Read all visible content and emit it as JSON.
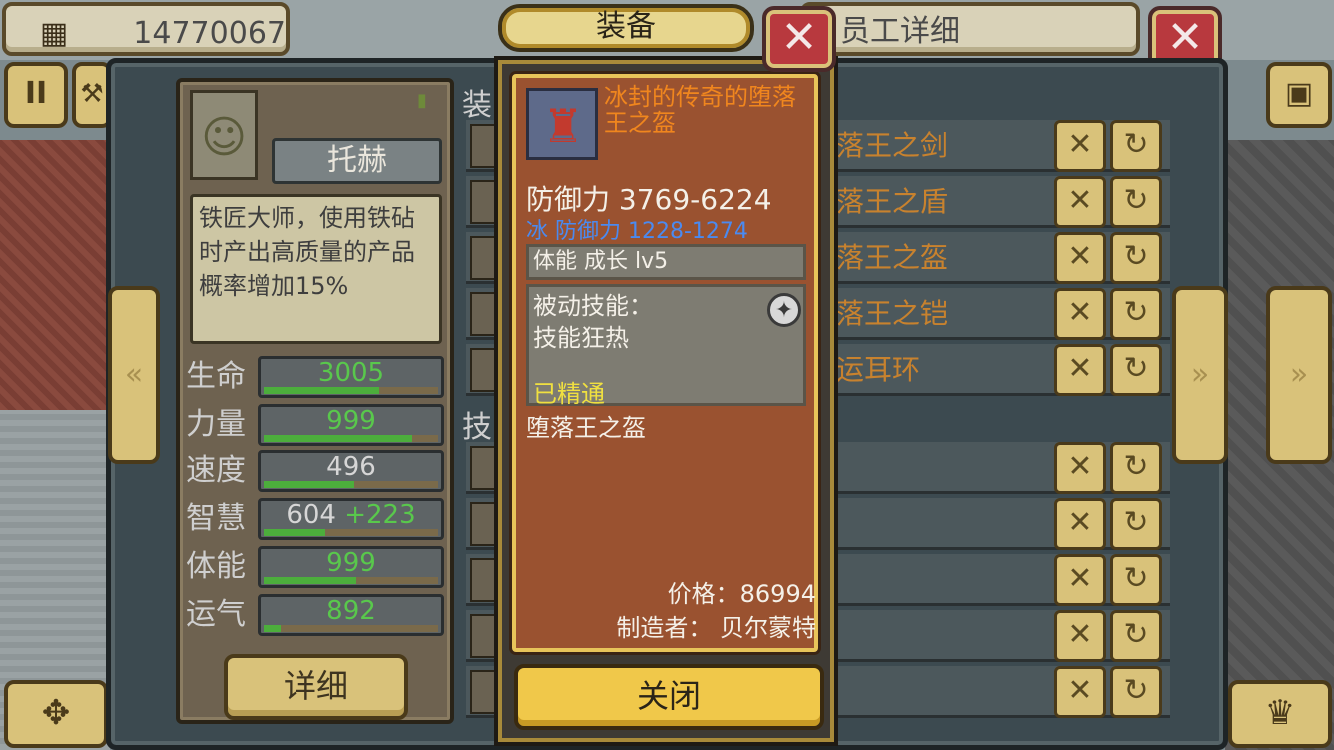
{
  "top_bar": {
    "coin_icon": "building-icon",
    "coin_value": "14770067",
    "staff_detail_title": "员工详细",
    "close_glyph": "✕"
  },
  "side_buttons": {
    "pause_glyph": "II",
    "hammer_glyph": "⚒",
    "camera_glyph": "▣",
    "move_glyph": "✥",
    "shop_glyph": "♛",
    "left_nav_glyph": "«",
    "right_nav_glyph": "»"
  },
  "character": {
    "name": "托赫",
    "portrait_glyph": "☺",
    "medal_glyph": "🎖",
    "description": "铁匠大师，使用铁砧时产出高质量的产品概率增加15%",
    "stats": [
      {
        "label": "生命",
        "value": "3005",
        "bonus": "",
        "fill": 0.66,
        "color": "#59c84c"
      },
      {
        "label": "力量",
        "value": "999",
        "bonus": "",
        "fill": 0.85,
        "color": "#59c84c"
      },
      {
        "label": "速度",
        "value": "496",
        "bonus": "",
        "fill": 0.52,
        "color": "#d6d6d6"
      },
      {
        "label": "智慧",
        "value": "604",
        "bonus": "+223",
        "fill": 0.35,
        "color": "#d6d6d6"
      },
      {
        "label": "体能",
        "value": "999",
        "bonus": "",
        "fill": 0.53,
        "color": "#59c84c"
      },
      {
        "label": "运气",
        "value": "892",
        "bonus": "",
        "fill": 0.1,
        "color": "#59c84c"
      }
    ],
    "detail_button": "详细"
  },
  "equipment_list": {
    "section_equip": "装",
    "section_skill": "技",
    "items": [
      {
        "name": "落王之剑"
      },
      {
        "name": "落王之盾"
      },
      {
        "name": "落王之盔"
      },
      {
        "name": "落王之铠"
      },
      {
        "name": "运耳环"
      }
    ],
    "skill_rows": 5,
    "remove_glyph": "✕",
    "swap_glyph": "↻"
  },
  "popup": {
    "title": "装备",
    "item_name": "冰封的传奇的堕落王之盔",
    "item_icon": "helmet-icon",
    "defense": "防御力 3769-6224",
    "ice_defense": "冰 防御力 1228-1274",
    "attribute": "体能 成长 lv5",
    "passive_label": "被动技能：",
    "skill_name": "技能狂热",
    "mastered": "已精通",
    "set_name": "堕落王之盔",
    "price": "价格：86994",
    "maker": "制造者： 贝尔蒙特",
    "close_button": "关闭",
    "close_glyph": "✕",
    "info_glyph": "✦"
  }
}
